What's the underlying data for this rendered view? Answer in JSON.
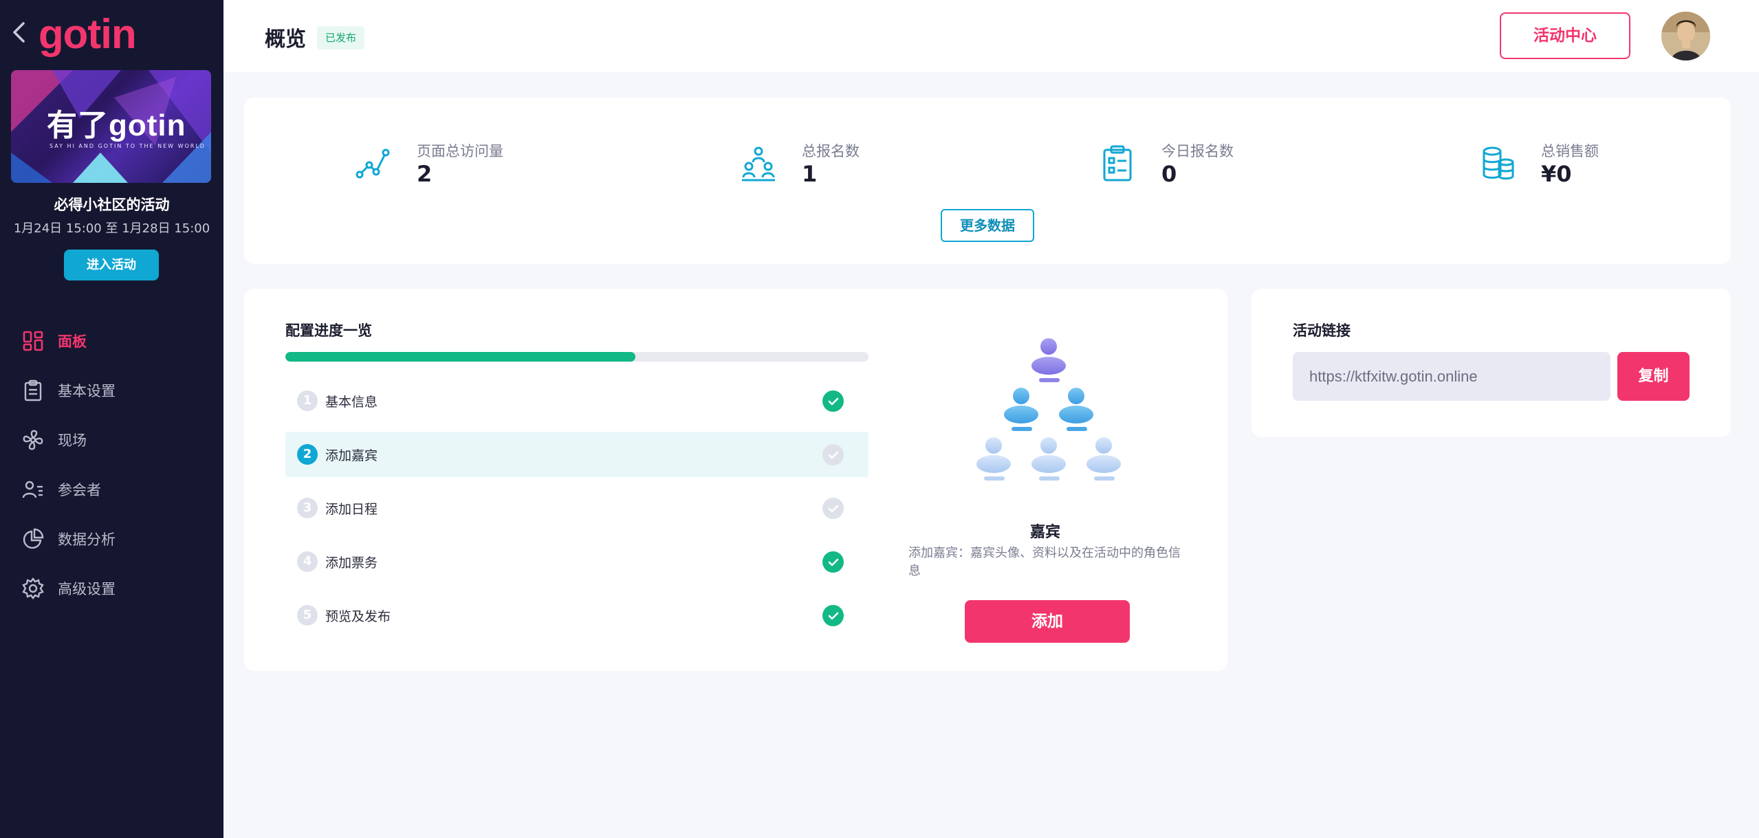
{
  "brand": {
    "logo_text": "gotin"
  },
  "banner": {
    "title": "有了gotin",
    "subtitle": "SAY HI AND GOTIN TO THE NEW WORLD"
  },
  "event": {
    "name": "必得小社区的活动",
    "date_range": "1月24日 15:00 至 1月28日 15:00",
    "enter_label": "进入活动"
  },
  "nav": {
    "items": [
      {
        "label": "面板",
        "icon": "dashboard-icon",
        "active": true
      },
      {
        "label": "基本设置",
        "icon": "clipboard-icon",
        "active": false
      },
      {
        "label": "现场",
        "icon": "fan-icon",
        "active": false
      },
      {
        "label": "参会者",
        "icon": "attendee-icon",
        "active": false
      },
      {
        "label": "数据分析",
        "icon": "pie-chart-icon",
        "active": false
      },
      {
        "label": "高级设置",
        "icon": "gear-icon",
        "active": false
      }
    ]
  },
  "header": {
    "title": "概览",
    "status": "已发布",
    "center_button": "活动中心"
  },
  "stats": {
    "items": [
      {
        "label": "页面总访问量",
        "value": "2",
        "icon": "trend-line-icon"
      },
      {
        "label": "总报名数",
        "value": "1",
        "icon": "people-group-icon"
      },
      {
        "label": "今日报名数",
        "value": "0",
        "icon": "clipboard-list-icon"
      },
      {
        "label": "总销售额",
        "value": "¥0",
        "icon": "coin-stack-icon"
      }
    ],
    "more_label": "更多数据"
  },
  "progress": {
    "title": "配置进度一览",
    "fraction": 0.6,
    "steps": [
      {
        "num": "1",
        "label": "基本信息",
        "done": true
      },
      {
        "num": "2",
        "label": "添加嘉宾",
        "done": false,
        "current": true
      },
      {
        "num": "3",
        "label": "添加日程",
        "done": false
      },
      {
        "num": "4",
        "label": "添加票务",
        "done": true
      },
      {
        "num": "5",
        "label": "预览及发布",
        "done": true
      }
    ],
    "guest": {
      "title": "嘉宾",
      "desc": "添加嘉宾：嘉宾头像、资料以及在活动中的角色信息",
      "add_label": "添加"
    }
  },
  "link": {
    "title": "活动链接",
    "url": "https://ktfxitw.gotin.online",
    "copy_label": "复制"
  },
  "colors": {
    "accent": "#f2366d",
    "teal": "#10a7d3",
    "success": "#12b886",
    "sidebar": "#151730"
  }
}
